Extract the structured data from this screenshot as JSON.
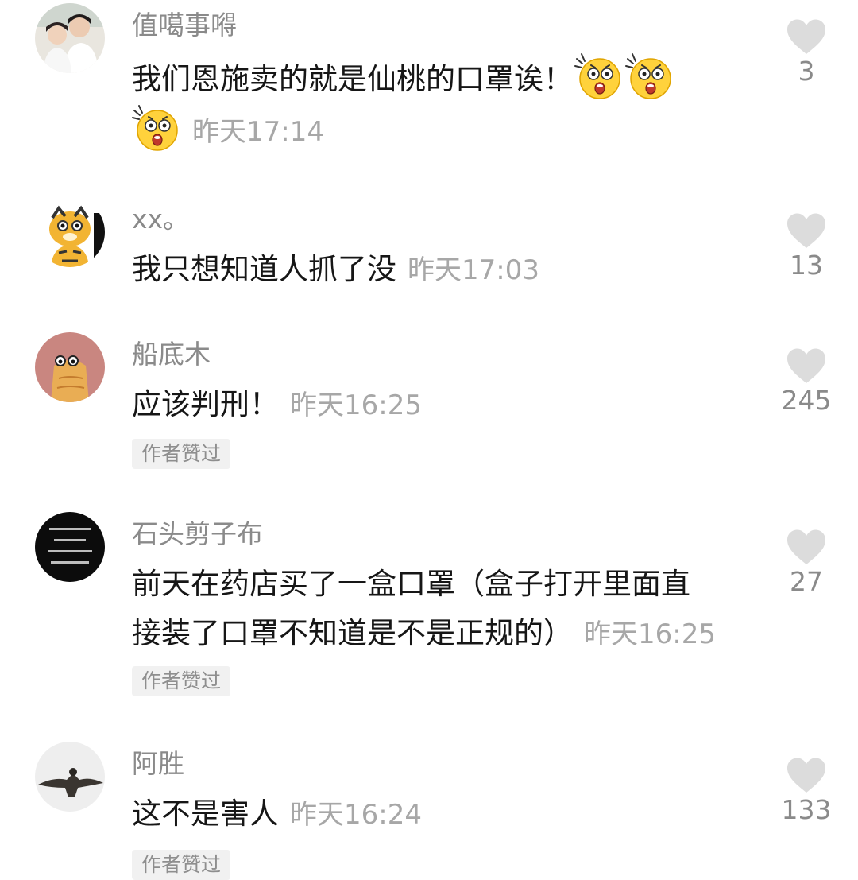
{
  "comments": [
    {
      "username": "值噶事嘚",
      "text": "我们恩施卖的就是仙桃的口罩诶！",
      "emojis": [
        "shocked-face-emoji",
        "shocked-face-emoji",
        "shocked-face-emoji"
      ],
      "time": "昨天17:14",
      "likes": "3",
      "badge": ""
    },
    {
      "username": "xx。",
      "text": "我只想知道人抓了没",
      "time": "昨天17:03",
      "likes": "13",
      "badge": ""
    },
    {
      "username": "船底木",
      "text": "应该判刑！",
      "time": "昨天16:25",
      "likes": "245",
      "badge": "作者赞过"
    },
    {
      "username": "石头剪子布",
      "text_line1": "前天在药店买了一盒口罩（盒子打开里面直",
      "text_line2": "接装了口罩不知道是不是正规的）",
      "time": "昨天16:25",
      "likes": "27",
      "badge": "作者赞过"
    },
    {
      "username": "阿胜",
      "text": "这不是害人",
      "time": "昨天16:24",
      "likes": "133",
      "badge": "作者赞过"
    }
  ],
  "colors": {
    "username": "#8a8a8a",
    "text": "#161616",
    "time": "#a7a7a7",
    "heart": "#dcdcdc",
    "badge_bg": "#f1f1f1",
    "emoji_yellow": "#ffd23c"
  }
}
